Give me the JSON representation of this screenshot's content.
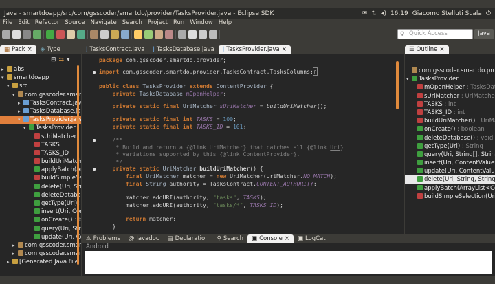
{
  "window": {
    "title": "Java - smartdoapp/src/com/gsscoder/smartdo/provider/TasksProvider.java - Eclipse SDK",
    "clock": "16.19",
    "user": "Giacomo Stelluti Scala"
  },
  "menu": [
    "File",
    "Edit",
    "Refactor",
    "Source",
    "Navigate",
    "Search",
    "Project",
    "Run",
    "Window",
    "Help"
  ],
  "quick_access": {
    "placeholder": "Quick Access"
  },
  "perspective": "Java",
  "left": {
    "tabs": [
      "Pack",
      "Type"
    ],
    "rows": [
      {
        "d": 0,
        "t": "abs",
        "tw": "▸",
        "c": "#c8a040"
      },
      {
        "d": 0,
        "t": "smartdoapp",
        "tw": "▾",
        "c": "#c8a040"
      },
      {
        "d": 1,
        "t": "src",
        "tw": "▾",
        "c": "#c8a040"
      },
      {
        "d": 2,
        "t": "com.gsscoder.smartd",
        "tw": "▾",
        "c": "#b08850"
      },
      {
        "d": 3,
        "t": "TasksContract.java",
        "tw": "▸",
        "c": "#6a9fd4"
      },
      {
        "d": 3,
        "t": "TasksDatabase.java",
        "tw": "▸",
        "c": "#6a9fd4"
      },
      {
        "d": 3,
        "t": "TasksProvider.java",
        "tw": "▾",
        "c": "#6a9fd4",
        "sel": true
      },
      {
        "d": 4,
        "t": "TasksProvider",
        "tw": "▾",
        "c": "#3f9f3f"
      },
      {
        "d": 5,
        "t": "sUriMatcher",
        "tw": "",
        "c": "#c04040"
      },
      {
        "d": 5,
        "t": "TASKS",
        "tw": "",
        "c": "#c04040"
      },
      {
        "d": 5,
        "t": "TASKS_ID",
        "tw": "",
        "c": "#c04040"
      },
      {
        "d": 5,
        "t": "buildUriMatcher",
        "tw": "",
        "c": "#c04040"
      },
      {
        "d": 5,
        "t": "applyBatch(Array",
        "tw": "",
        "c": "#3f9f3f"
      },
      {
        "d": 5,
        "t": "buildSimpleSelec",
        "tw": "",
        "c": "#c04040"
      },
      {
        "d": 5,
        "t": "delete(Uri, String",
        "tw": "",
        "c": "#3f9f3f"
      },
      {
        "d": 5,
        "t": "deleteDatabase(",
        "tw": "",
        "c": "#3f9f3f"
      },
      {
        "d": 5,
        "t": "getType(Uri)",
        "g": " : Str",
        "tw": "",
        "c": "#3f9f3f"
      },
      {
        "d": 5,
        "t": "insert(Uri, Conter",
        "tw": "",
        "c": "#3f9f3f"
      },
      {
        "d": 5,
        "t": "onCreate()",
        "g": " : bool",
        "tw": "",
        "c": "#3f9f3f"
      },
      {
        "d": 5,
        "t": "query(Uri, String[",
        "tw": "",
        "c": "#3f9f3f"
      },
      {
        "d": 5,
        "t": "update(Uri, Conte",
        "tw": "",
        "c": "#3f9f3f"
      },
      {
        "d": 2,
        "t": "com.gsscoder.smartd",
        "tw": "▸",
        "c": "#b08850"
      },
      {
        "d": 2,
        "t": "com.gsscoder.smartd",
        "tw": "▸",
        "c": "#b08850"
      },
      {
        "d": 1,
        "t": "[Generated Java File",
        "tw": "▸",
        "c": "#c8a040"
      }
    ]
  },
  "editor": {
    "tabs": [
      "TasksContract.java",
      "TasksDatabase.java",
      "TasksProvider.java"
    ]
  },
  "outline": {
    "tab": "Outline",
    "rows": [
      {
        "d": 0,
        "t": "com.gsscoder.smartdo.provider",
        "tw": "",
        "c": "#b08850"
      },
      {
        "d": 0,
        "t": "TasksProvider",
        "tw": "▾",
        "c": "#3f9f3f"
      },
      {
        "d": 1,
        "t": "mOpenHelper",
        "g": " : TasksDatal",
        "tw": "",
        "c": "#c04040"
      },
      {
        "d": 1,
        "t": "sUriMatcher",
        "g": " : UriMatcher",
        "tw": "",
        "c": "#c04040"
      },
      {
        "d": 1,
        "t": "TASKS",
        "g": " : int",
        "tw": "",
        "c": "#c04040"
      },
      {
        "d": 1,
        "t": "TASKS_ID",
        "g": " : int",
        "tw": "",
        "c": "#c04040"
      },
      {
        "d": 1,
        "t": "buildUriMatcher()",
        "g": " : UriMatc",
        "tw": "",
        "c": "#c04040"
      },
      {
        "d": 1,
        "t": "onCreate()",
        "g": " : boolean",
        "tw": "",
        "c": "#3f9f3f"
      },
      {
        "d": 1,
        "t": "deleteDatabase()",
        "g": " : void",
        "tw": "",
        "c": "#3f9f3f"
      },
      {
        "d": 1,
        "t": "getType(Uri)",
        "g": " : String",
        "tw": "",
        "c": "#3f9f3f"
      },
      {
        "d": 1,
        "t": "query(Uri, String[], String,",
        "tw": "",
        "c": "#3f9f3f"
      },
      {
        "d": 1,
        "t": "insert(Uri, ContentValues)",
        "tw": "",
        "c": "#3f9f3f"
      },
      {
        "d": 1,
        "t": "update(Uri, ContentValues,",
        "tw": "",
        "c": "#3f9f3f"
      },
      {
        "d": 1,
        "t": "delete(Uri, String, String[]",
        "tw": "",
        "c": "#3f9f3f",
        "hl": true
      },
      {
        "d": 1,
        "t": "applyBatch(ArrayList<Conte",
        "tw": "",
        "c": "#3f9f3f"
      },
      {
        "d": 1,
        "t": "buildSimpleSelection(Uri)",
        "tw": "",
        "c": "#c04040"
      }
    ]
  },
  "console": {
    "tabs": [
      "Problems",
      "Javadoc",
      "Declaration",
      "Search",
      "Console",
      "LogCat"
    ],
    "label": "Android"
  }
}
